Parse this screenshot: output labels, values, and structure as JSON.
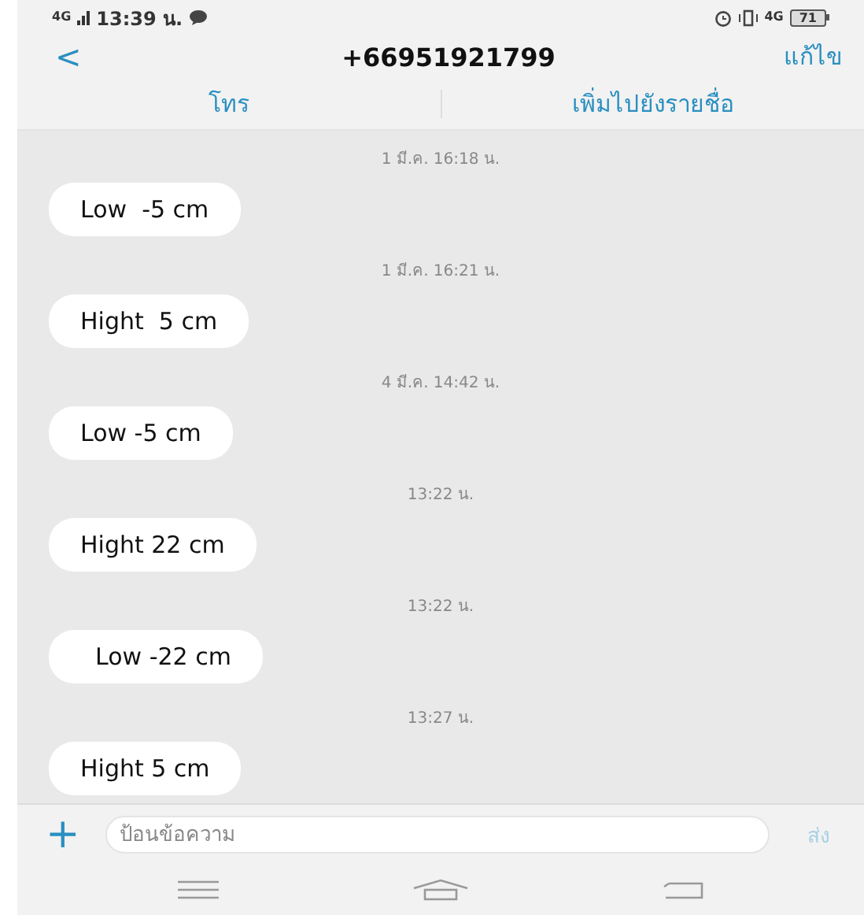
{
  "status_bar": {
    "network": "4G",
    "time": "13:39 น.",
    "data_type": "4G",
    "battery": "71"
  },
  "header": {
    "back": "<",
    "title": "+66951921799",
    "edit": "แก้ไข"
  },
  "actions": [
    {
      "label": "โทร"
    },
    {
      "label": "เพิ่มไปยังรายชื่อ"
    }
  ],
  "messages": [
    {
      "timestamp": "1 มี.ค. 16:18 น.",
      "text": "Low  -5 cm"
    },
    {
      "timestamp": "1 มี.ค. 16:21 น.",
      "text": "Hight  5 cm"
    },
    {
      "timestamp": "4 มี.ค. 14:42 น.",
      "text": "Low -5 cm"
    },
    {
      "timestamp": "13:22 น.",
      "text": "Hight 22 cm"
    },
    {
      "timestamp": "13:22 น.",
      "text": "  Low -22 cm"
    },
    {
      "timestamp": "13:27 น.",
      "text": "Hight 5 cm"
    }
  ],
  "composer": {
    "add": "+",
    "placeholder": "ป้อนข้อความ",
    "send": "ส่ง",
    "send_disabled": true
  }
}
